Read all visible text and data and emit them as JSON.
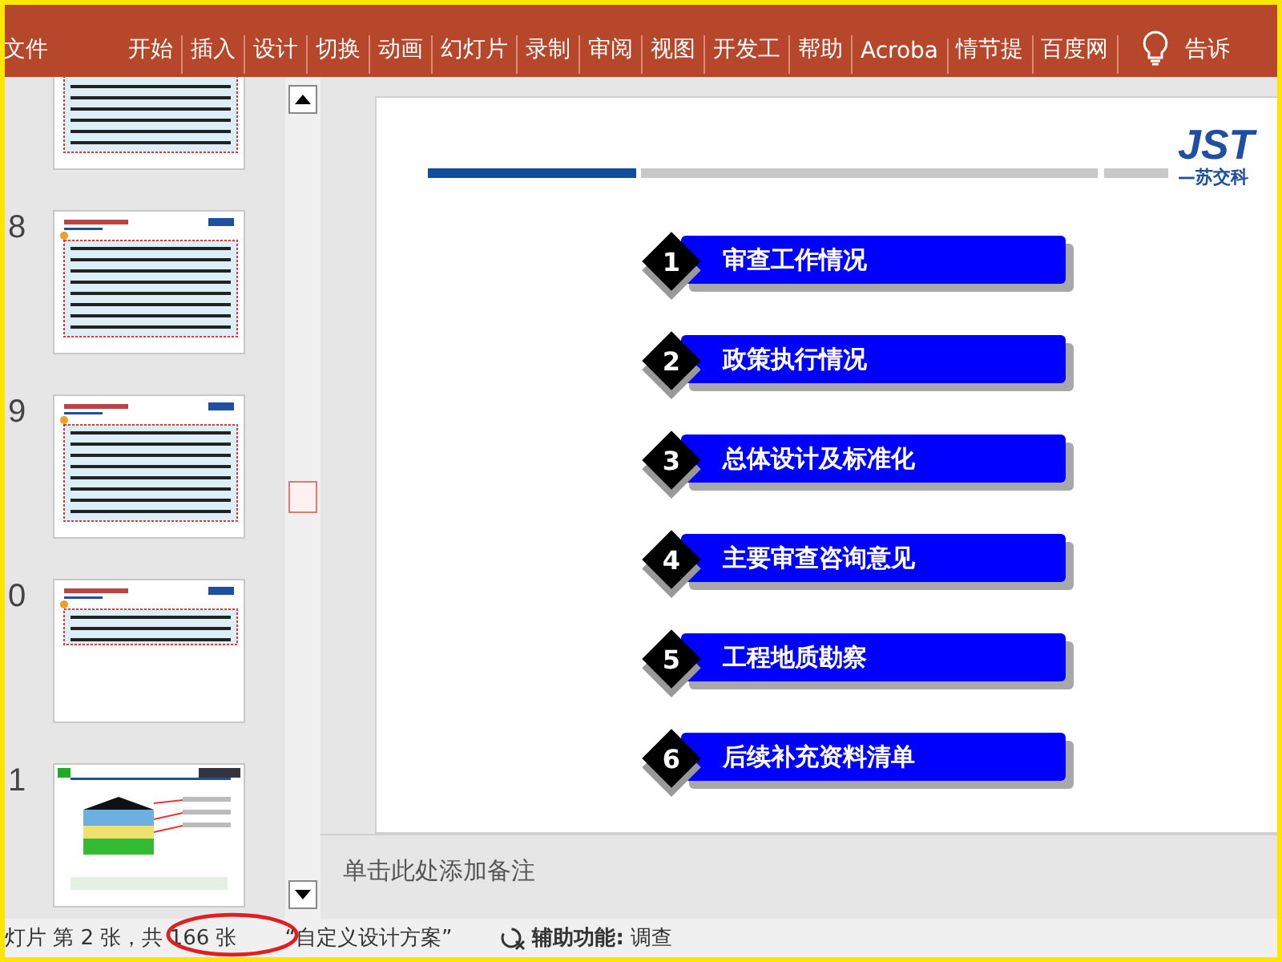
{
  "ribbon": {
    "tabs": [
      {
        "label": "文件",
        "selected": false
      },
      {
        "label": "开始",
        "selected": false
      },
      {
        "label": "插入",
        "selected": false
      },
      {
        "label": "设计",
        "selected": false
      },
      {
        "label": "切换",
        "selected": false
      },
      {
        "label": "动画",
        "selected": false
      },
      {
        "label": "幻灯片",
        "selected": false
      },
      {
        "label": "录制",
        "selected": false
      },
      {
        "label": "审阅",
        "selected": false
      },
      {
        "label": "视图",
        "selected": false
      },
      {
        "label": "开发工",
        "selected": false
      },
      {
        "label": "帮助",
        "selected": false
      },
      {
        "label": "Acroba",
        "selected": false
      },
      {
        "label": "情节提",
        "selected": false
      },
      {
        "label": "百度网",
        "selected": false
      }
    ],
    "tell_me": "告诉"
  },
  "thumbnails": [
    {
      "kind": "text"
    },
    {
      "number": "8",
      "kind": "text"
    },
    {
      "number": "9",
      "kind": "text"
    },
    {
      "number": "0",
      "kind": "short"
    },
    {
      "number": "1",
      "kind": "diagram"
    }
  ],
  "slide": {
    "logo": "JST",
    "logo_sub": "—苏交科",
    "items": [
      {
        "number": "1",
        "label": "审查工作情况"
      },
      {
        "number": "2",
        "label": "政策执行情况"
      },
      {
        "number": "3",
        "label": "总体设计及标准化"
      },
      {
        "number": "4",
        "label": "主要审查咨询意见"
      },
      {
        "number": "5",
        "label": "工程地质勘察"
      },
      {
        "number": "6",
        "label": "后续补充资料清单"
      }
    ]
  },
  "notes": {
    "placeholder": "单击此处添加备注"
  },
  "status_bar": {
    "slide_info": "灯片 第 2 张，共 166 张",
    "theme": "“自定义设计方案”",
    "accessibility": "**辅助功能:** 调查"
  }
}
